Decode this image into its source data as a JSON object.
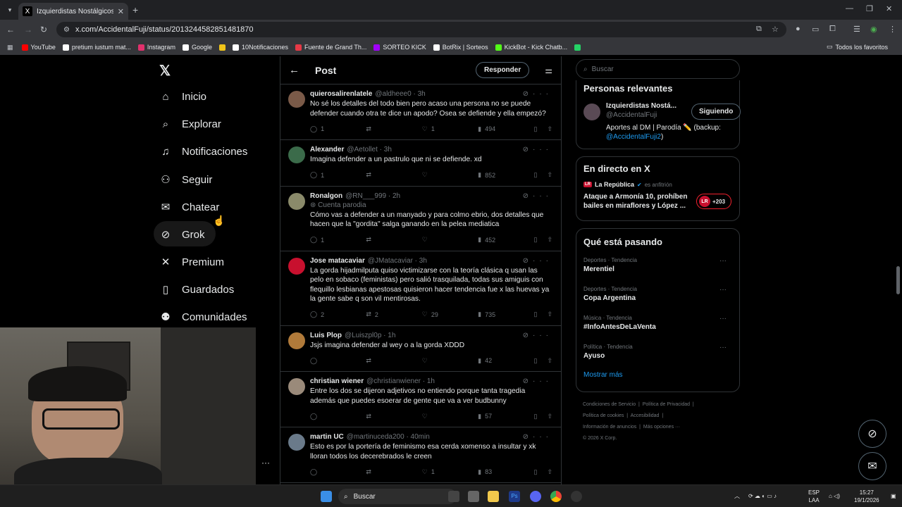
{
  "browser": {
    "tab_title": "Izquierdistas Nostálgicos De Se",
    "url": "x.com/AccidentalFuji/status/2013244582851481870",
    "bookmarks": [
      {
        "label": "YouTube",
        "color": "#ff0000"
      },
      {
        "label": "pretium iustum mat...",
        "color": "#ffffff"
      },
      {
        "label": "Instagram",
        "color": "#e1306c"
      },
      {
        "label": "Google",
        "color": "#ffffff"
      },
      {
        "label": "",
        "color": "#f0c419"
      },
      {
        "label": "10Notificaciones",
        "color": "#ffffff"
      },
      {
        "label": "Fuente de Grand Th...",
        "color": "#e63946"
      },
      {
        "label": "SORTEO KICK",
        "color": "#a000ff"
      },
      {
        "label": "BotRix | Sorteos",
        "color": "#ffffff"
      },
      {
        "label": "KickBot - Kick Chatb...",
        "color": "#53fc18"
      },
      {
        "label": "",
        "color": "#25d366"
      }
    ],
    "all_bookmarks": "Todos los favoritos"
  },
  "sidebar": {
    "items": [
      {
        "label": "Inicio",
        "icon": "home-icon",
        "glyph": "⌂"
      },
      {
        "label": "Explorar",
        "icon": "search-icon",
        "glyph": "⌕"
      },
      {
        "label": "Notificaciones",
        "icon": "bell-icon",
        "glyph": "♫"
      },
      {
        "label": "Seguir",
        "icon": "follow-icon",
        "glyph": "⚇"
      },
      {
        "label": "Chatear",
        "icon": "mail-icon",
        "glyph": "✉"
      },
      {
        "label": "Grok",
        "icon": "grok-icon",
        "glyph": "⊘"
      },
      {
        "label": "Premium",
        "icon": "x-icon",
        "glyph": "✕"
      },
      {
        "label": "Guardados",
        "icon": "bookmark-icon",
        "glyph": "▯"
      },
      {
        "label": "Comunidades",
        "icon": "communities-icon",
        "glyph": "⚉"
      }
    ]
  },
  "main": {
    "title": "Post",
    "reply_button": "Responder",
    "tweets": [
      {
        "name": "quierosalirenlatele",
        "handle": "@aldheee0 · 3h",
        "sub": "",
        "text": "No sé los detalles del todo bien pero acaso una persona no se puede defender cuando otra te dice un apodo? Osea se defiende y ella empezó?",
        "replies": "1",
        "retweets": "",
        "likes": "1",
        "views": "494",
        "avatar": "#7a5a48"
      },
      {
        "name": "Alexander",
        "handle": "@Aetollet · 3h",
        "sub": "",
        "text": "Imagina defender a un pastrulo que ni se defiende. xd",
        "replies": "1",
        "retweets": "",
        "likes": "",
        "views": "852",
        "avatar": "#3b6b4a"
      },
      {
        "name": "Ronalgon",
        "handle": "@RN___999 · 2h",
        "sub": "Cuenta parodia",
        "text": "Cómo vas a defender a un manyado y para colmo ebrio, dos detalles que hacen que la \"gordita\" salga ganando en la pelea mediatica",
        "replies": "1",
        "retweets": "",
        "likes": "",
        "views": "452",
        "avatar": "#8a8a6a"
      },
      {
        "name": "Jose matacaviar",
        "handle": "@JMatacaviar · 3h",
        "sub": "",
        "text": "La gorda hijadmilputa quiso victimizarse con la teoría clásica q usan las pelo en sobaco (feministas) pero salió trasquilada, todas sus amiguis con flequillo lesbianas apestosas quisieron hacer tendencia fue x las huevas ya la gente sabe q son vil mentirosas.",
        "replies": "2",
        "retweets": "2",
        "likes": "29",
        "views": "735",
        "avatar": "#c8102e"
      },
      {
        "name": "Luis Plop",
        "handle": "@Luiszpl0p · 1h",
        "sub": "",
        "text": "Jsjs imagina defender al wey o a la gorda XDDD",
        "replies": "",
        "retweets": "",
        "likes": "",
        "views": "42",
        "avatar": "#b07a3a"
      },
      {
        "name": "christian wiener",
        "handle": "@christianwiener · 1h",
        "sub": "",
        "text": "Entre los dos se dijeron adjetivos no entiendo porque tanta tragedia además que puedes esoerar de gente que va a ver budbunny",
        "replies": "",
        "retweets": "",
        "likes": "",
        "views": "57",
        "avatar": "#9a8a7a"
      },
      {
        "name": "martin UC",
        "handle": "@martinuceda200 · 40min",
        "sub": "",
        "text": "Esto es por la portería de feminismo esa cerda xomenso a insultar y xk lloran todos los decerebrados le creen",
        "replies": "",
        "retweets": "",
        "likes": "1",
        "views": "83",
        "avatar": "#6a7a8a"
      }
    ]
  },
  "right": {
    "search_placeholder": "Buscar",
    "relevant_title": "Personas relevantes",
    "person": {
      "name": "Izquierdistas Nostá...",
      "handle": "@AccidentalFuji",
      "bio": "Aportes al DM | Parodía ✏️ (backup:",
      "bio_link": "@AccidentalFuji2",
      "bio_end": ")",
      "follow": "Siguiendo"
    },
    "live_title": "En directo en X",
    "live": {
      "host": "La República",
      "host_role": "es anfitrión",
      "title": "Ataque a Armonía 10, prohíben bailes en miraflores y López ...",
      "badge": "LR",
      "count": "+203"
    },
    "trends_title": "Qué está pasando",
    "trends": [
      {
        "category": "Deportes · Tendencia",
        "name": "Merentiel"
      },
      {
        "category": "Deportes · Tendencia",
        "name": "Copa Argentina"
      },
      {
        "category": "Música · Tendencia",
        "name": "#InfoAntesDeLaVenta"
      },
      {
        "category": "Política · Tendencia",
        "name": "Ayuso"
      }
    ],
    "show_more": "Mostrar más",
    "footer": {
      "l1a": "Condiciones de Servicio",
      "l1b": "Política de Privacidad",
      "l2a": "Política de cookies",
      "l2b": "Accesibilidad",
      "l3a": "Información de anuncios",
      "l3b": "Más opciones ···",
      "l4": "© 2026 X Corp."
    }
  },
  "taskbar": {
    "search": "Buscar",
    "lang": "ESP",
    "lang2": "LAA",
    "time": "15:27",
    "date": "19/1/2026"
  }
}
